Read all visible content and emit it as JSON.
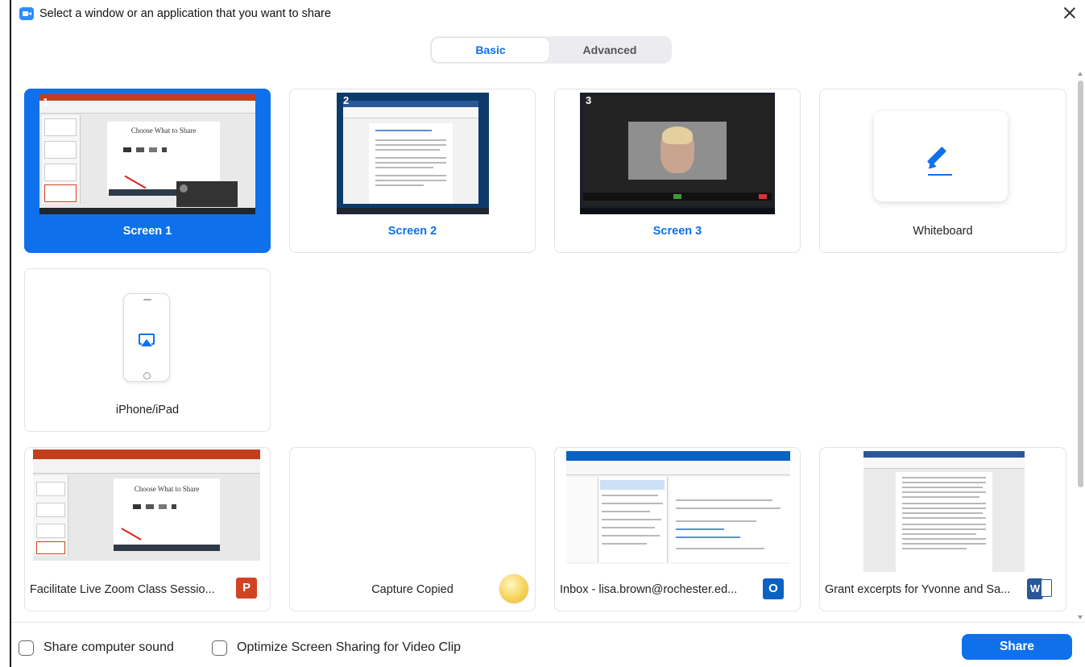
{
  "window": {
    "title": "Select a window or an application that you want to share",
    "close_icon": "close-icon",
    "app_icon": "zoom-camera-icon"
  },
  "tabs": [
    {
      "label": "Basic",
      "active": true
    },
    {
      "label": "Advanced",
      "active": false
    }
  ],
  "screens": [
    {
      "number": "1",
      "label": "Screen 1",
      "selected": true
    },
    {
      "number": "2",
      "label": "Screen 2",
      "selected": false
    },
    {
      "number": "3",
      "label": "Screen 3",
      "selected": false
    }
  ],
  "whiteboard": {
    "label": "Whiteboard",
    "icon": "pencil-icon"
  },
  "iphone": {
    "label": "iPhone/iPad",
    "icon": "airplay-icon"
  },
  "windows": [
    {
      "label": "Facilitate Live Zoom Class Sessio...",
      "app_icon": "powerpoint-icon",
      "thumb_title": "Choose What to Share"
    },
    {
      "label": "Capture Copied",
      "app_icon": "capture-icon"
    },
    {
      "label": "Inbox - lisa.brown@rochester.ed...",
      "app_icon": "outlook-icon"
    },
    {
      "label": "Grant excerpts for Yvonne and Sa...",
      "app_icon": "word-icon"
    }
  ],
  "screen1_thumb_title": "Choose What to Share",
  "footer": {
    "share_sound_label": "Share computer sound",
    "optimize_label": "Optimize Screen Sharing for Video Clip",
    "share_button": "Share"
  },
  "colors": {
    "accent": "#0e71eb",
    "ppt": "#d04423",
    "outlook": "#0a62c4",
    "word": "#2b5797"
  }
}
